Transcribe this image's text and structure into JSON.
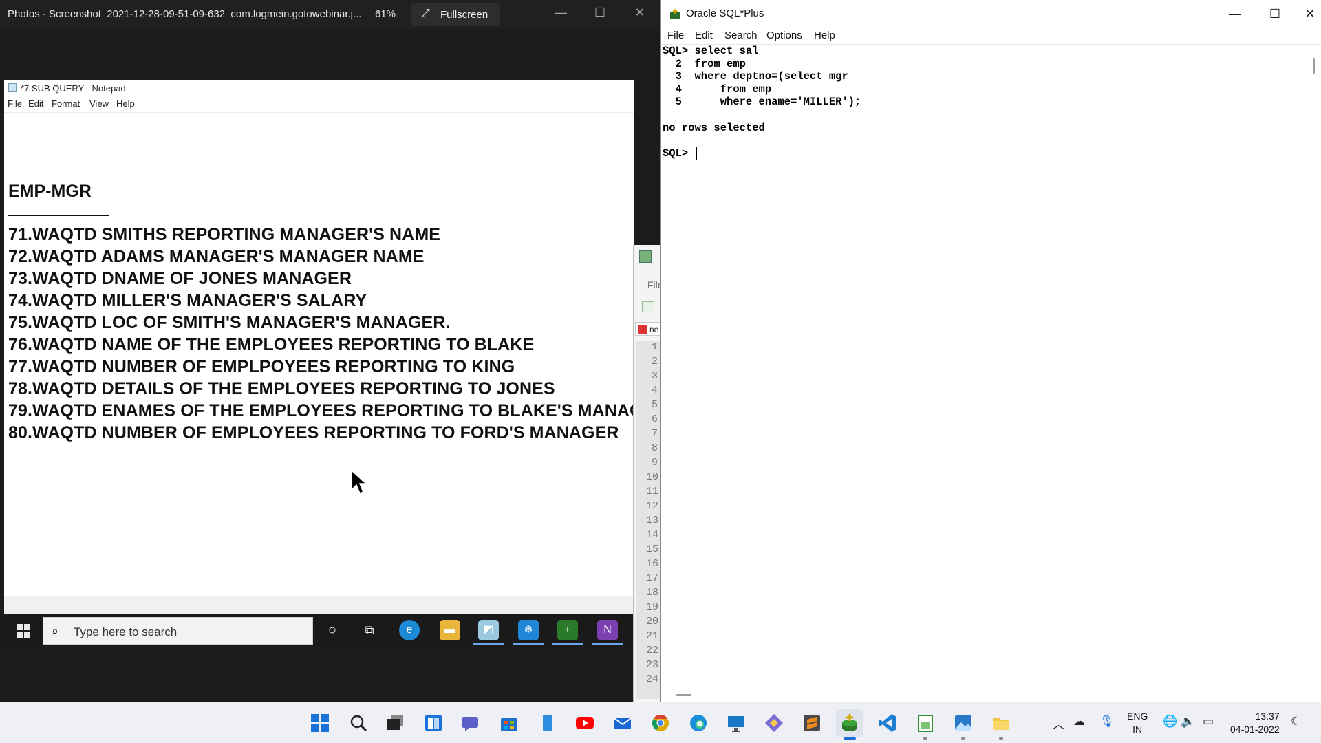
{
  "photos": {
    "title": "Photos - Screenshot_2021-12-28-09-51-09-632_com.logmein.gotowebinar.j...",
    "zoom": "61%",
    "fullscreen_label": "Fullscreen",
    "notepad": {
      "title": "*7 SUB QUERY - Notepad",
      "menu": [
        "File",
        "Edit",
        "Format",
        "View",
        "Help"
      ],
      "heading": "EMP-MGR",
      "lines": [
        "71.WAQTD SMITHS REPORTING MANAGER'S NAME",
        "72.WAQTD ADAMS MANAGER'S MANAGER NAME",
        "73.WAQTD DNAME OF JONES MANAGER",
        "74.WAQTD MILLER'S MANAGER'S SALARY",
        "75.WAQTD LOC OF SMITH'S MANAGER'S MANAGER.",
        "76.WAQTD NAME OF THE EMPLOYEES REPORTING TO BLAKE",
        "77.WAQTD NUMBER OF EMPLPOYEES REPORTING TO KING",
        "78.WAQTD DETAILS OF THE EMPLOYEES REPORTING TO JONES",
        "79.WAQTD ENAMES OF THE EMPLOYEES REPORTING TO BLAKE'S MANAG",
        "80.WAQTD NUMBER OF EMPLOYEES REPORTING TO FORD'S MANAGER"
      ]
    },
    "inner_taskbar": {
      "search_placeholder": "Type here to search"
    },
    "peek_editor": {
      "menu_file": "File",
      "tab_label": "ne",
      "line_numbers": [
        "1",
        "2",
        "3",
        "4",
        "5",
        "6",
        "7",
        "8",
        "9",
        "10",
        "11",
        "12",
        "13",
        "14",
        "15",
        "16",
        "17",
        "18",
        "19",
        "20",
        "21",
        "22",
        "23",
        "24"
      ]
    }
  },
  "sqlplus": {
    "title": "Oracle SQL*Plus",
    "menu": [
      "File",
      "Edit",
      "Search",
      "Options",
      "Help"
    ],
    "console_lines": [
      "SQL> select sal",
      "  2  from emp",
      "  3  where deptno=(select mgr",
      "  4      from emp",
      "  5      where ename='MILLER');",
      "",
      "no rows selected",
      "",
      "SQL> "
    ]
  },
  "taskbar": {
    "apps": [
      {
        "name": "start",
        "color": "#1a73d9"
      },
      {
        "name": "search",
        "color": "#222222"
      },
      {
        "name": "task-view",
        "color": "#333333"
      },
      {
        "name": "widgets",
        "color": "#1a73d9"
      },
      {
        "name": "teams-chat",
        "color": "#5b5fc7"
      },
      {
        "name": "microsoft-store",
        "color": "#1f6fcc"
      },
      {
        "name": "phone-link",
        "color": "#2d8ee0"
      },
      {
        "name": "youtube",
        "color": "#ff0000"
      },
      {
        "name": "mail",
        "color": "#1967d2"
      },
      {
        "name": "chrome",
        "color": "#e0a800"
      },
      {
        "name": "edge",
        "color": "#1a8fd9"
      },
      {
        "name": "remote-desktop",
        "color": "#1979c9"
      },
      {
        "name": "git",
        "color": "#7b68d9"
      },
      {
        "name": "sublime-text",
        "color": "#f28b1c"
      },
      {
        "name": "sql-plus",
        "color": "#2a7a2a"
      },
      {
        "name": "vscode",
        "color": "#1f7fd1"
      },
      {
        "name": "notepad-plus",
        "color": "#2f8f2f"
      },
      {
        "name": "photos",
        "color": "#2a79c9"
      },
      {
        "name": "file-explorer",
        "color": "#f4c542"
      }
    ],
    "lang_line1": "ENG",
    "lang_line2": "IN",
    "time": "13:37",
    "date": "04-01-2022"
  }
}
